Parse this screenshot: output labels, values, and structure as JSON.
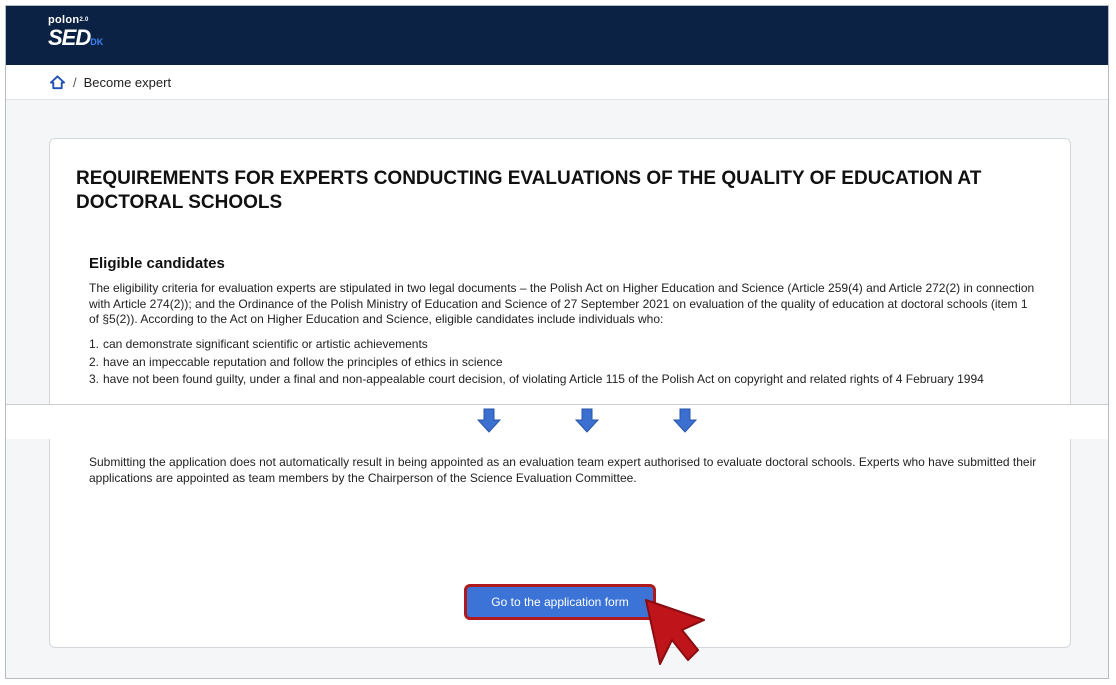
{
  "header": {
    "logo_top": "polon",
    "logo_sup": "2.0",
    "logo_main": "SED",
    "logo_suffix": "DK"
  },
  "breadcrumb": {
    "home_icon": "home-icon",
    "current": "Become expert"
  },
  "content": {
    "title": "REQUIREMENTS FOR EXPERTS CONDUCTING EVALUATIONS OF THE QUALITY OF EDUCATION AT DOCTORAL SCHOOLS",
    "section_heading": "Eligible candidates",
    "paragraph1": "The eligibility criteria for evaluation experts are stipulated in two legal documents – the Polish Act on Higher Education and Science (Article 259(4) and Article 272(2) in connection with Article 274(2)); and the Ordinance of the Polish Ministry of Education and Science of 27 September 2021 on evaluation of the quality of education at doctoral schools (item 1 of §5(2)). According to the Act on Higher Education and Science, eligible candidates include individuals who:",
    "criteria": [
      {
        "num": "1.",
        "text": "can demonstrate significant scientific or artistic achievements"
      },
      {
        "num": "2.",
        "text": "have an impeccable reputation and follow the principles of ethics in science"
      },
      {
        "num": "3.",
        "text": "have not been found guilty, under a final and non-appealable court decision, of violating Article 115 of the Polish Act on copyright and related rights of 4 February 1994"
      }
    ],
    "paragraph2": "Submitting the application does not automatically result in being appointed as an evaluation team expert authorised to evaluate doctoral schools. Experts who have submitted their applications are appointed as team members by the Chairperson of the Science Evaluation Committee.",
    "cta_label": "Go to the application form"
  },
  "overlay": {
    "arrow_icon": "arrow-down-icon",
    "cursor_icon": "pointer-arrow-icon",
    "colors": {
      "arrow": "#3b6fd0",
      "cursor": "#c0141b",
      "highlight": "#b0191e",
      "brand": "#0b2245"
    }
  }
}
